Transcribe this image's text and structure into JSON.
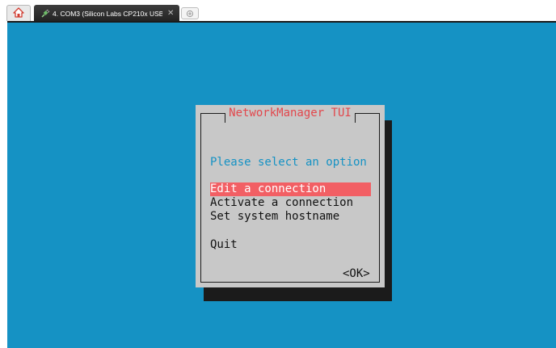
{
  "tabs": {
    "home_icon": "home-icon",
    "session_title": "4. COM3  (Silicon Labs CP210x USB",
    "close_glyph": "✕",
    "new_tab_icon": "new-tab-icon"
  },
  "terminal": {
    "background": "#1592c4",
    "dialog": {
      "title": "NetworkManager TUI",
      "prompt": "Please select an option",
      "items": [
        {
          "label": "Edit a connection",
          "selected": true
        },
        {
          "label": "Activate a connection",
          "selected": false
        },
        {
          "label": "Set system hostname",
          "selected": false
        },
        {
          "label": "Quit",
          "selected": false
        }
      ],
      "ok_label": "<OK>",
      "colors": {
        "title": "#e2474c",
        "prompt": "#1592c4",
        "selection": "#f25f64",
        "dialog_bg": "#c8c8c8"
      }
    }
  }
}
